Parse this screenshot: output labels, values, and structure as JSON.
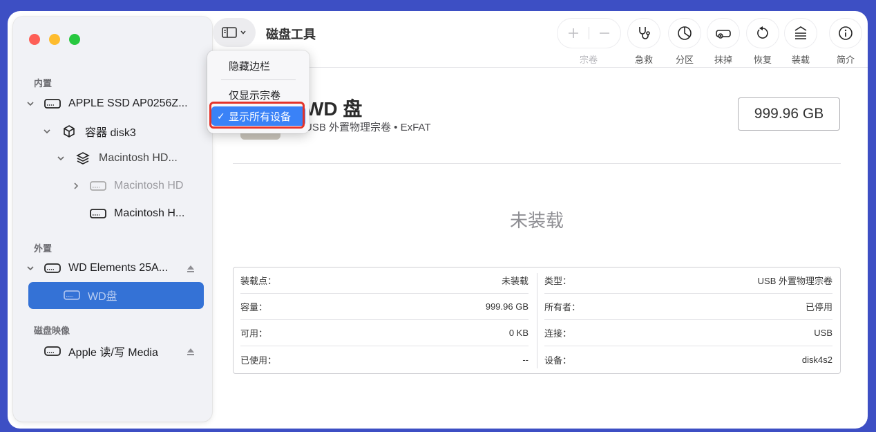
{
  "app_title": "磁盘工具",
  "sidebar": {
    "sections": [
      {
        "title": "内置"
      },
      {
        "title": "外置"
      },
      {
        "title": "磁盘映像"
      }
    ],
    "items": [
      {
        "label": "APPLE SSD AP0256Z..."
      },
      {
        "label": "容器 disk3"
      },
      {
        "label": "Macintosh HD..."
      },
      {
        "label": "Macintosh HD"
      },
      {
        "label": "Macintosh H..."
      },
      {
        "label": "WD Elements 25A..."
      },
      {
        "label": "WD盘"
      },
      {
        "label": "Apple 读/写 Media"
      }
    ]
  },
  "toolbar": {
    "volume_label": "宗卷",
    "firstaid_label": "急救",
    "partition_label": "分区",
    "erase_label": "抹掉",
    "restore_label": "恢复",
    "mount_label": "装载",
    "info_label": "简介"
  },
  "menu": {
    "hide_sidebar": "隐藏边栏",
    "show_volumes_only": "仅显示宗卷",
    "show_all_devices": "显示所有设备"
  },
  "disk": {
    "name": "WD 盘",
    "subtitle": "USB 外置物理宗卷 • ExFAT",
    "size": "999.96 GB",
    "status": "未装载"
  },
  "info": {
    "left": [
      {
        "k": "装载点：",
        "v": "未装载"
      },
      {
        "k": "容量：",
        "v": "999.96 GB"
      },
      {
        "k": "可用：",
        "v": "0 KB"
      },
      {
        "k": "已使用：",
        "v": "--"
      }
    ],
    "right": [
      {
        "k": "类型：",
        "v": "USB 外置物理宗卷"
      },
      {
        "k": "所有者：",
        "v": "已停用"
      },
      {
        "k": "连接：",
        "v": "USB"
      },
      {
        "k": "设备：",
        "v": "disk4s2"
      }
    ]
  },
  "colors": {
    "accent": "#3472d6",
    "menu_highlight": "#3a82f7",
    "annotation_box": "#e5332a"
  }
}
